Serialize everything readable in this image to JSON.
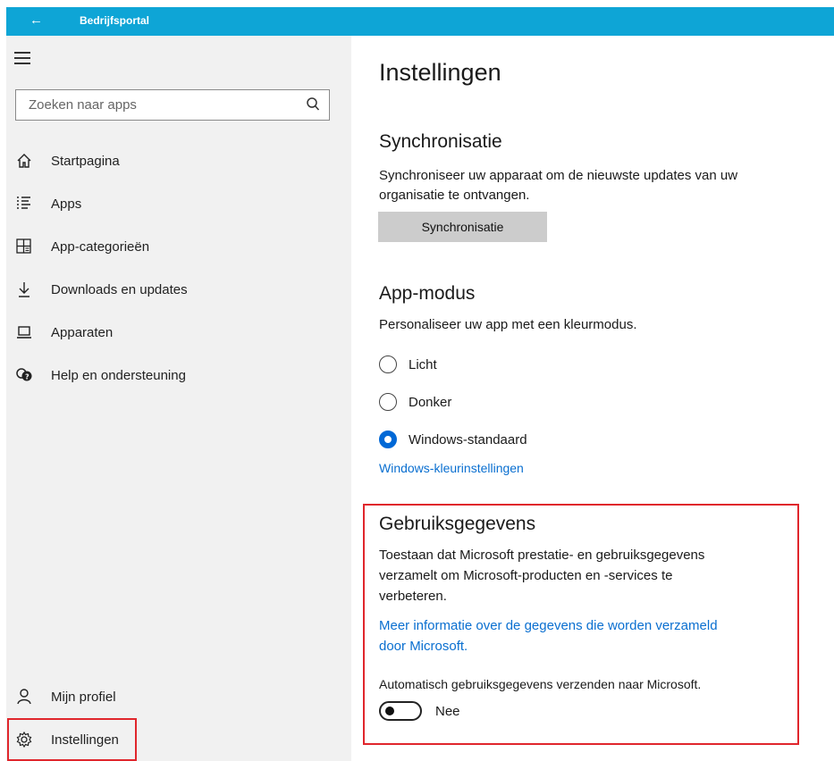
{
  "titlebar": {
    "back_glyph": "←",
    "title": "Bedrijfsportal",
    "color": "#0ea5d6"
  },
  "search": {
    "placeholder": "Zoeken naar apps"
  },
  "nav": {
    "items": [
      {
        "label": "Startpagina",
        "icon": "home-icon"
      },
      {
        "label": "Apps",
        "icon": "apps-list-icon"
      },
      {
        "label": "App-categorieën",
        "icon": "categories-icon"
      },
      {
        "label": "Downloads en updates",
        "icon": "download-icon"
      },
      {
        "label": "Apparaten",
        "icon": "laptop-icon"
      },
      {
        "label": "Help en ondersteuning",
        "icon": "help-icon"
      }
    ],
    "bottom": [
      {
        "label": "Mijn profiel",
        "icon": "person-icon"
      },
      {
        "label": "Instellingen",
        "icon": "gear-icon"
      }
    ]
  },
  "main": {
    "title": "Instellingen",
    "sync": {
      "heading": "Synchronisatie",
      "line1": "Synchroniseer uw apparaat om de nieuwste updates van uw",
      "line2": "organisatie te ontvangen.",
      "button": "Synchronisatie"
    },
    "mode": {
      "heading": "App-modus",
      "desc": "Personaliseer uw app met een kleurmodus.",
      "options": [
        "Licht",
        "Donker",
        "Windows-standaard"
      ],
      "selected": "Windows-standaard",
      "link": "Windows-kleurinstellingen"
    },
    "usage": {
      "heading": "Gebruiksgegevens",
      "line1": "Toestaan dat Microsoft prestatie- en gebruiksgegevens",
      "line2": "verzamelt om Microsoft-producten en -services te",
      "line3": "verbeteren.",
      "link1": "Meer informatie over de gegevens die worden verzameld",
      "link2": "door Microsoft.",
      "toggle_label": "Automatisch gebruiksgegevens verzenden naar Microsoft.",
      "toggle_state": "Nee"
    }
  },
  "colors": {
    "accent": "#0068d6",
    "link": "#0a6fd0",
    "highlight": "#e0262c"
  }
}
